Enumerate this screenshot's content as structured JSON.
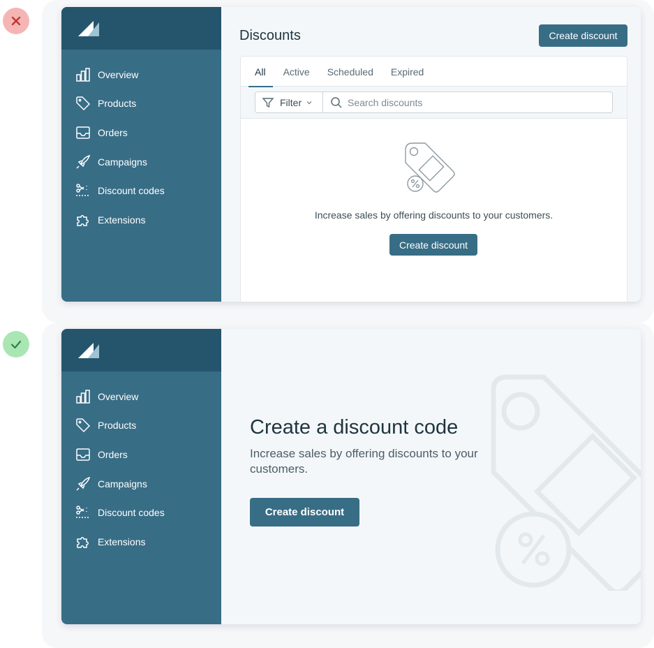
{
  "bad_example": {
    "badge_icon": "close-icon",
    "badge_color": "#f5b5b5",
    "sidebar": {
      "logo": "logo-icon",
      "items": [
        {
          "label": "Overview",
          "icon": "bar-chart-icon"
        },
        {
          "label": "Products",
          "icon": "tag-icon"
        },
        {
          "label": "Orders",
          "icon": "inbox-icon"
        },
        {
          "label": "Campaigns",
          "icon": "rocket-icon"
        },
        {
          "label": "Discount codes",
          "icon": "scissors-icon"
        },
        {
          "label": "Extensions",
          "icon": "puzzle-icon"
        }
      ]
    },
    "header": {
      "title": "Discounts",
      "create_button": "Create discount"
    },
    "tabs": [
      "All",
      "Active",
      "Scheduled",
      "Expired"
    ],
    "active_tab": "All",
    "filter": {
      "label": "Filter",
      "search_placeholder": "Search discounts"
    },
    "empty_state": {
      "icon": "discount-tag-icon",
      "message": "Increase sales by offering discounts to your customers.",
      "button": "Create discount"
    }
  },
  "good_example": {
    "badge_icon": "check-icon",
    "badge_color": "#a9e6b3",
    "sidebar": {
      "logo": "logo-icon",
      "items": [
        {
          "label": "Overview",
          "icon": "bar-chart-icon"
        },
        {
          "label": "Products",
          "icon": "tag-icon"
        },
        {
          "label": "Orders",
          "icon": "inbox-icon"
        },
        {
          "label": "Campaigns",
          "icon": "rocket-icon"
        },
        {
          "label": "Discount codes",
          "icon": "scissors-icon"
        },
        {
          "label": "Extensions",
          "icon": "puzzle-icon"
        }
      ]
    },
    "hero": {
      "title": "Create a discount code",
      "subtitle": "Increase sales by offering discounts to your customers.",
      "button": "Create discount",
      "illustration": "discount-tag-illustration"
    }
  },
  "colors": {
    "sidebar": "#386d86",
    "sidebar_header": "#25556c",
    "primary_button": "#386d86",
    "content_bg": "#f4f7f9",
    "illustration": "#e2e8ec"
  }
}
